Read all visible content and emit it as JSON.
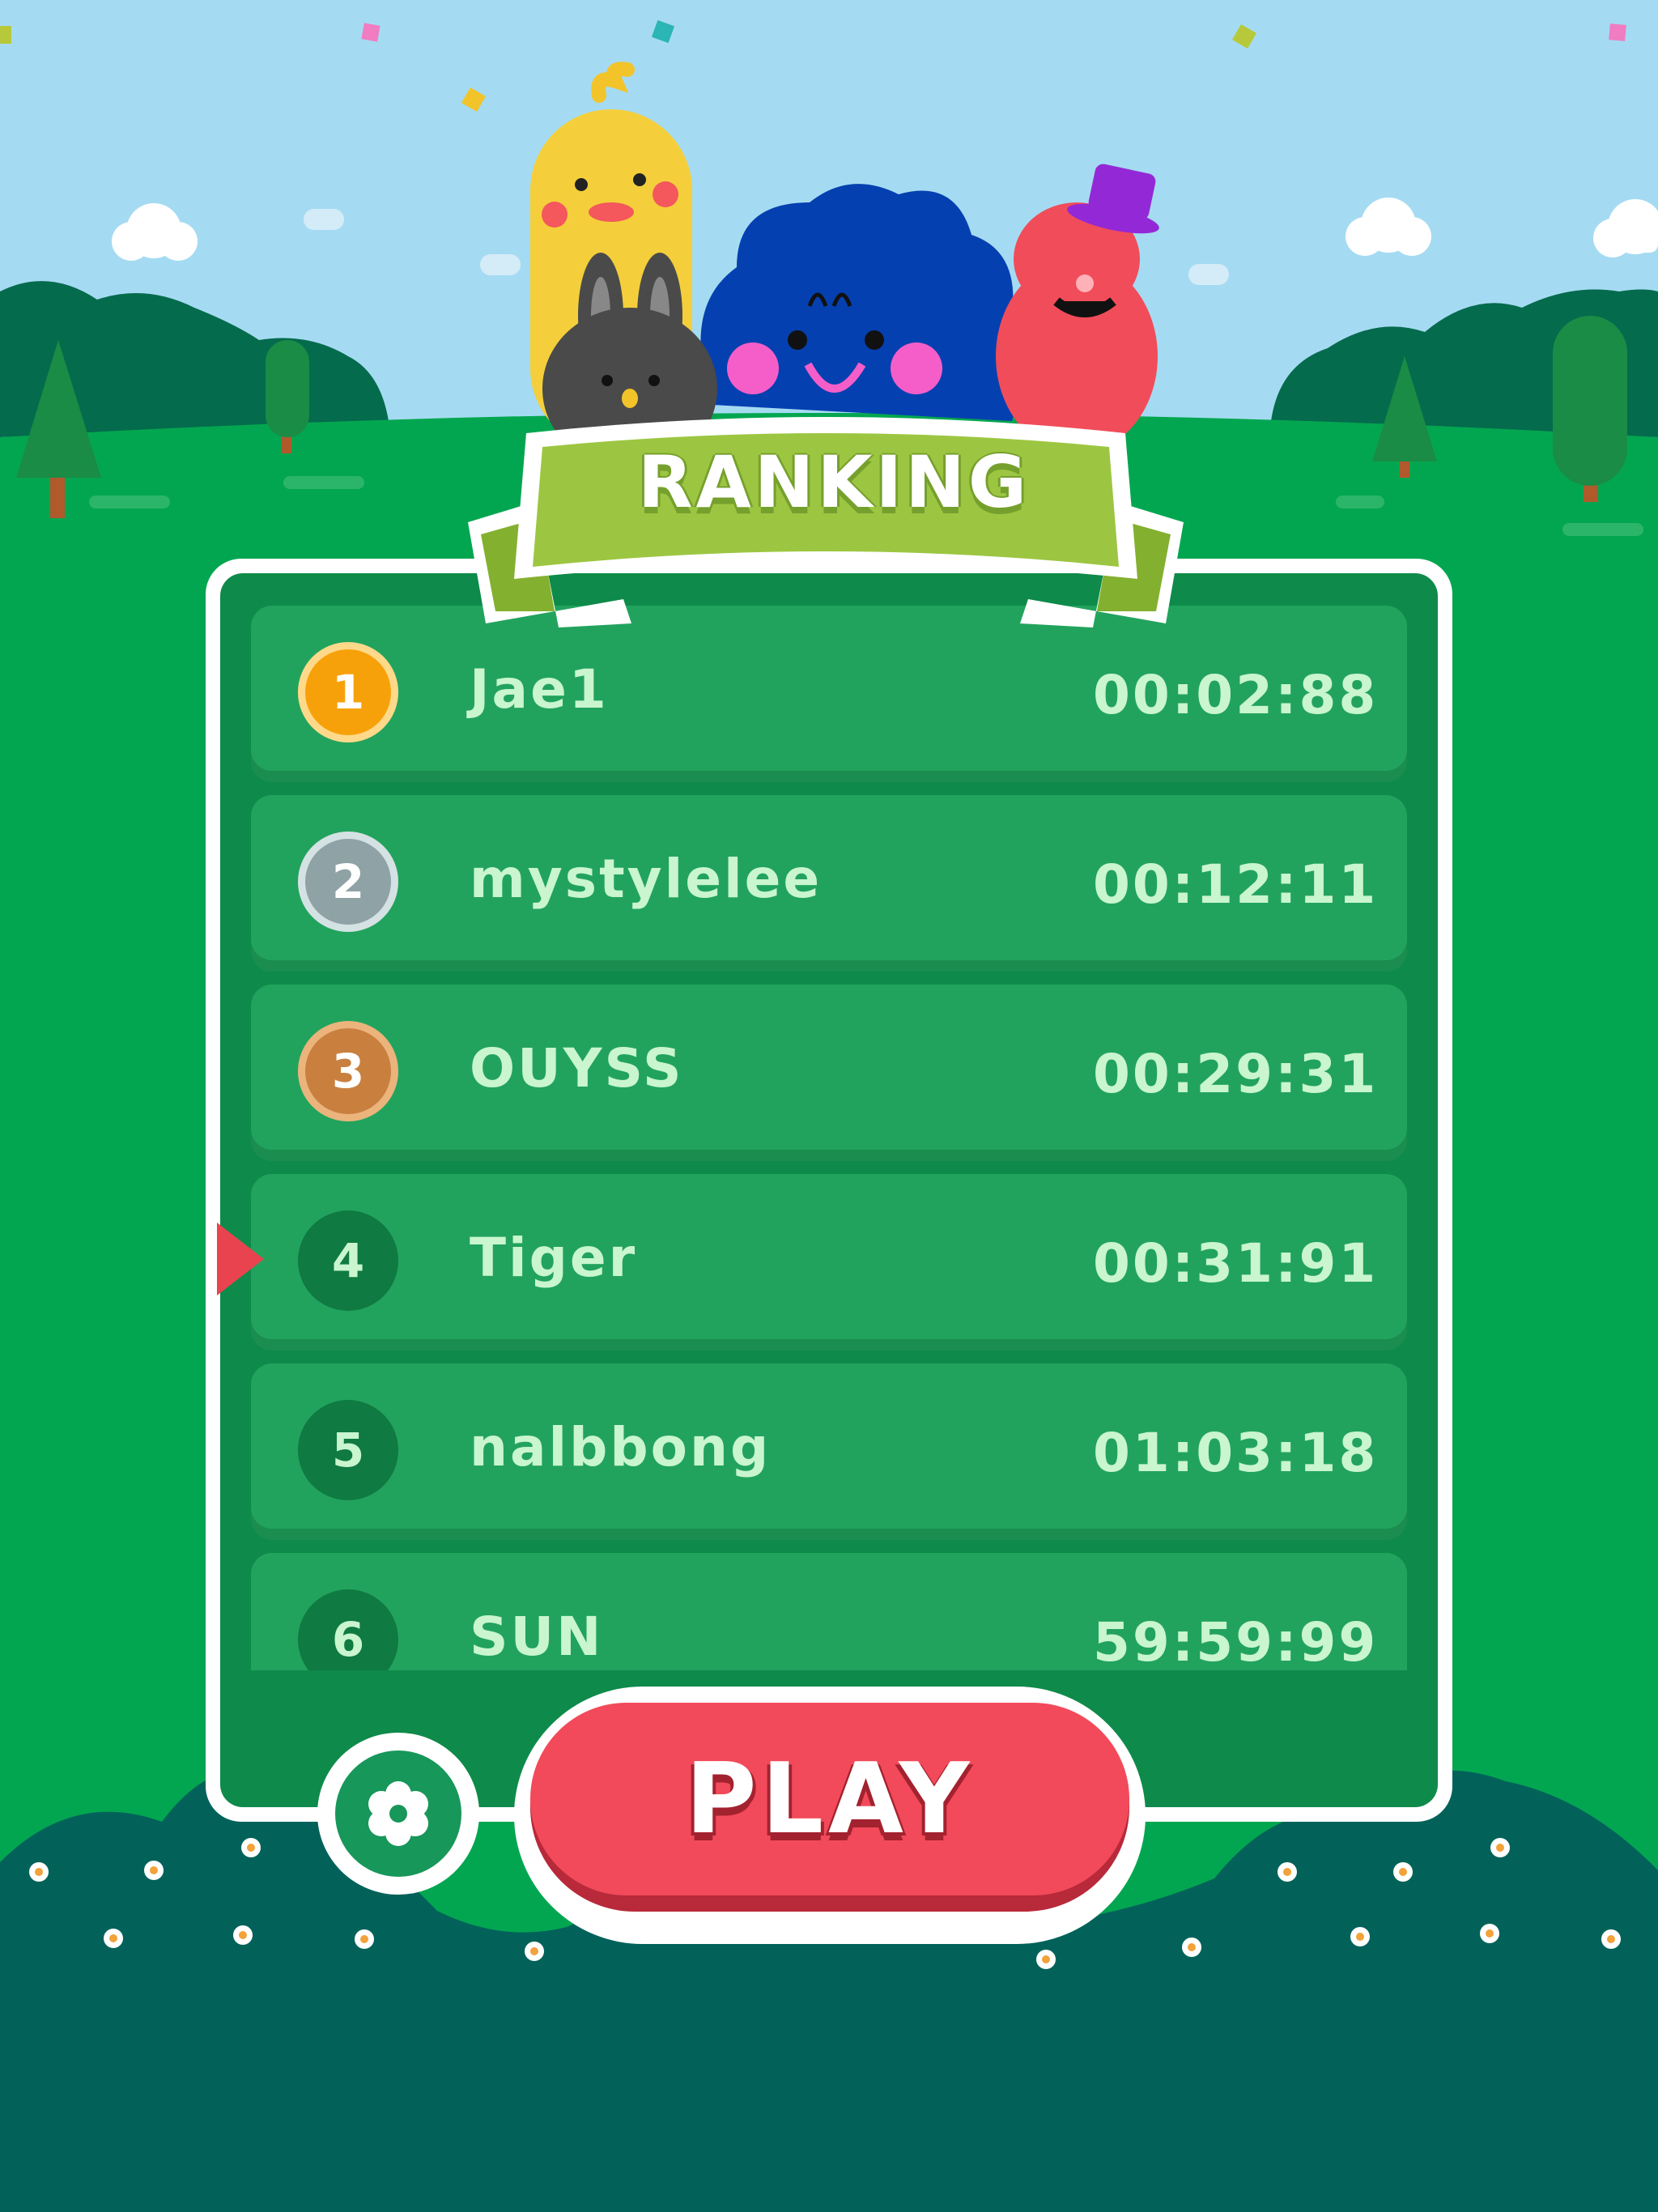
{
  "header": {
    "title": "RANKING"
  },
  "ranking": {
    "entries": [
      {
        "rank": "1",
        "name": "Jae1",
        "time": "00:02:88",
        "medal": "gold"
      },
      {
        "rank": "2",
        "name": "mystylelee",
        "time": "00:12:11",
        "medal": "silver"
      },
      {
        "rank": "3",
        "name": "OUYSS",
        "time": "00:29:31",
        "medal": "bronze"
      },
      {
        "rank": "4",
        "name": "Tiger",
        "time": "00:31:91",
        "medal": "none",
        "current_player": true
      },
      {
        "rank": "5",
        "name": "nalbbong",
        "time": "01:03:18",
        "medal": "none"
      },
      {
        "rank": "6",
        "name": "SUN",
        "time": "59:59:99",
        "medal": "none"
      }
    ]
  },
  "buttons": {
    "play_label": "PLAY",
    "settings_icon": "gear-icon"
  },
  "colors": {
    "sky": "#a5dbf2",
    "grass": "#03a650",
    "bush_dark": "#02625a",
    "panel": "#0e8a4a",
    "row": "#22a35d",
    "text": "#c9f5cf",
    "ribbon": "#9cc641",
    "play": "#f24a5a",
    "gold": "#f7a10a",
    "silver": "#8fa2a6",
    "bronze": "#c9803f",
    "indicator": "#e8434f"
  }
}
